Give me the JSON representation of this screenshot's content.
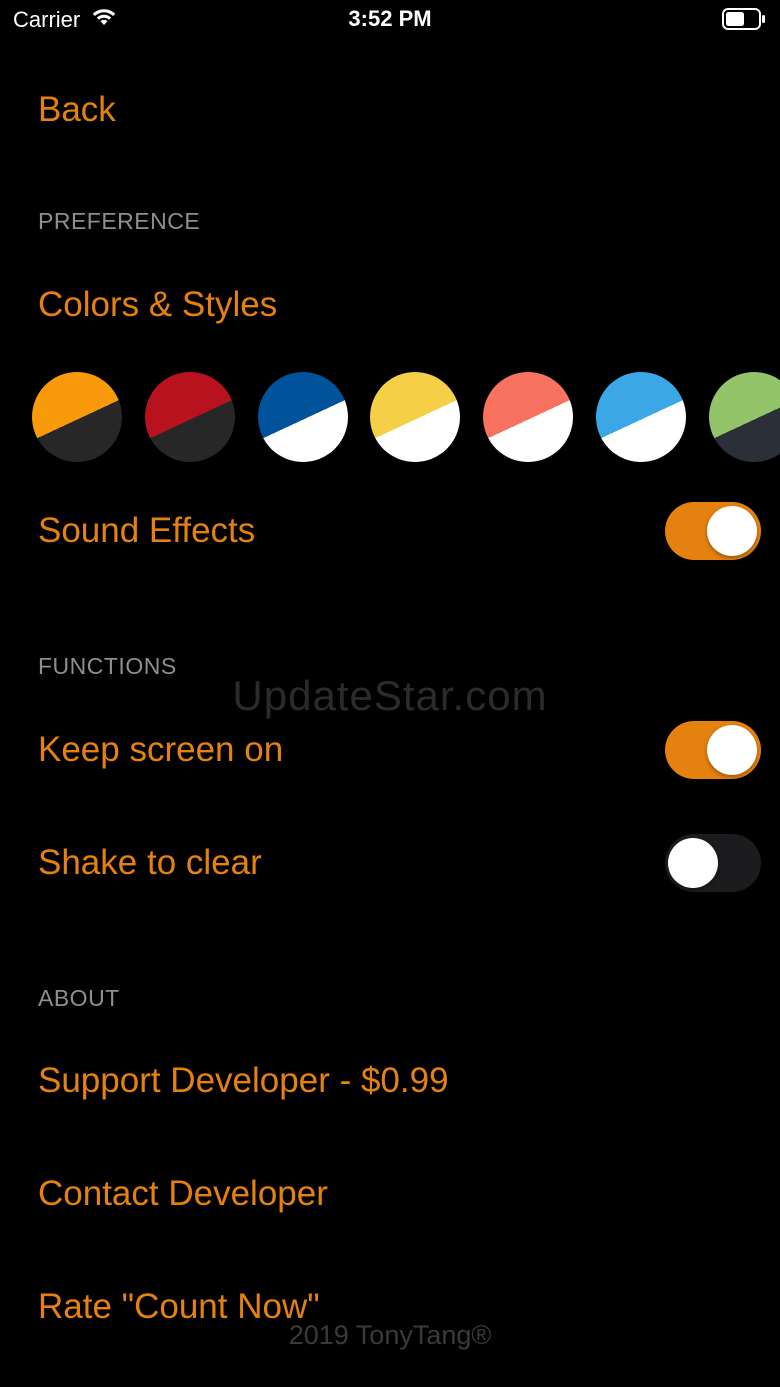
{
  "status_bar": {
    "carrier": "Carrier",
    "time": "3:52 PM",
    "wifi_icon": "wifi-icon",
    "battery_icon": "battery-icon"
  },
  "nav": {
    "back_label": "Back"
  },
  "preference": {
    "header": "PREFERENCE",
    "colors_label": "Colors & Styles",
    "swatches": [
      {
        "name": "orange-dark",
        "top": "#f99a0a",
        "bottom": "#272727"
      },
      {
        "name": "red-dark",
        "top": "#b8121f",
        "bottom": "#272727"
      },
      {
        "name": "blue-white",
        "top": "#00529b",
        "bottom": "#ffffff"
      },
      {
        "name": "yellow-white",
        "top": "#f5cf45",
        "bottom": "#ffffff"
      },
      {
        "name": "salmon-white",
        "top": "#f7725f",
        "bottom": "#ffffff"
      },
      {
        "name": "skyblue-white",
        "top": "#3ba7e4",
        "bottom": "#ffffff"
      },
      {
        "name": "green-dark",
        "top": "#93c46a",
        "bottom": "#2b2f38"
      }
    ],
    "sound_label": "Sound Effects",
    "sound_on": true
  },
  "functions": {
    "header": "FUNCTIONS",
    "keep_screen_label": "Keep screen on",
    "keep_screen_on": true,
    "shake_label": "Shake to clear",
    "shake_on": false
  },
  "about": {
    "header": "ABOUT",
    "support_label": "Support Developer - $0.99",
    "contact_label": "Contact Developer",
    "rate_label": "Rate \"Count Now\""
  },
  "watermark": "UpdateStar.com",
  "footer": "2019 TonyTang®",
  "colors": {
    "accent": "#e5820f",
    "background": "#000000",
    "header_gray": "#8e8e93",
    "toggle_off": "#1c1c1e"
  }
}
